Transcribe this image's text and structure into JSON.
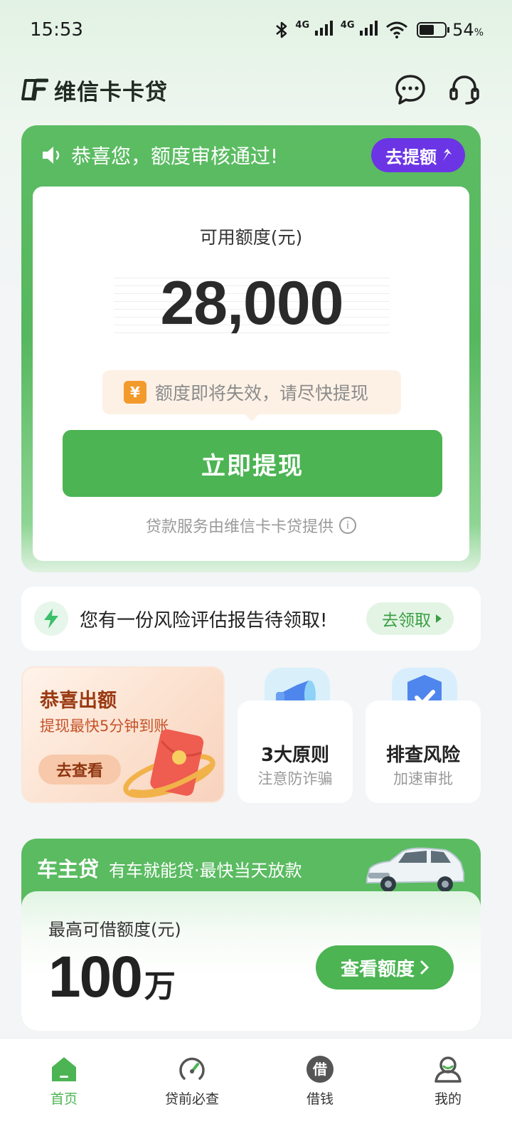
{
  "status_bar": {
    "time": "15:53",
    "network_1": "4G",
    "network_2": "4G",
    "battery_percent": "54",
    "battery_unit": "%"
  },
  "header": {
    "app_name": "维信卡卡贷",
    "icons": [
      "message-icon",
      "customer-service-icon"
    ]
  },
  "quota_card": {
    "notice": "恭喜您，额度审核通过!",
    "raise_button": "去提额",
    "label": "可用额度(元)",
    "amount": "28,000",
    "expire_tip": "额度即将失效，请尽快提现",
    "yen_symbol": "¥",
    "withdraw_button": "立即提现",
    "service_note": "贷款服务由维信卡卡贷提供"
  },
  "risk_report": {
    "text": "您有一份风险评估报告待领取!",
    "button": "去领取"
  },
  "promos": {
    "main": {
      "title": "恭喜出额",
      "subtitle": "提现最快5分钟到账",
      "button": "去查看"
    },
    "cards": [
      {
        "title": "3大原则",
        "subtitle": "注意防诈骗",
        "icon": "megaphone-icon"
      },
      {
        "title": "排查风险",
        "subtitle": "加速审批",
        "icon": "shield-check-icon"
      }
    ]
  },
  "car_loan": {
    "title": "车主贷",
    "tagline": "有车就能贷·最快当天放款",
    "label": "最高可借额度(元)",
    "amount": "100",
    "unit": "万",
    "button": "查看额度"
  },
  "bottom_nav": {
    "items": [
      {
        "label": "首页",
        "icon": "home-icon",
        "active": true
      },
      {
        "label": "贷前必查",
        "icon": "gauge-icon",
        "active": false
      },
      {
        "label": "借钱",
        "icon": "borrow-icon",
        "active": false
      },
      {
        "label": "我的",
        "icon": "profile-icon",
        "active": false
      }
    ]
  },
  "colors": {
    "brand_green": "#4cb453",
    "accent_purple": "#6b35e6",
    "tip_orange": "#f39a2c"
  }
}
